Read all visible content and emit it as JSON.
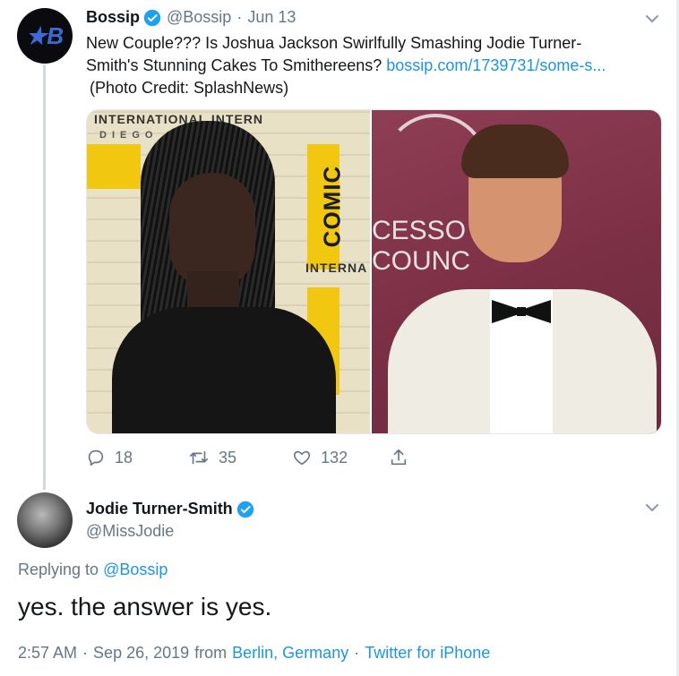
{
  "tweet": {
    "author_name": "Bossip",
    "handle": "@Bossip",
    "date": "Jun 13",
    "text_line1": "New Couple??? Is Joshua Jackson Swirlfully Smashing Jodie Turner-",
    "text_line2_plain": "Smith's Stunning Cakes To Smithereens? ",
    "link_text": "bossip.com/1739731/some-s...",
    "credit": "(Photo Credit: SplashNews)",
    "avatar_glyph": "★B",
    "media": {
      "left_sign_top": "INTERNATIONAL   INTERN",
      "left_sign_sub": "DIEGO   SAN D",
      "left_comic": "COMIC",
      "left_sign_mid": "INTERNA",
      "right_sign": "CESSO",
      "right_sign2": "COUNC"
    },
    "actions": {
      "replies": "18",
      "retweets": "35",
      "likes": "132"
    }
  },
  "reply": {
    "author_name": "Jodie Turner-Smith",
    "handle": "@MissJodie",
    "replying_to_prefix": "Replying to ",
    "replying_to_handle": "@Bossip",
    "text": "yes. the answer is yes.",
    "time": "2:57 AM",
    "date": "Sep 26, 2019",
    "from": "from",
    "location": "Berlin, Germany",
    "client": "Twitter for iPhone"
  },
  "colors": {
    "link": "#1b95e0",
    "muted": "#657786",
    "verified": "#1da1f2"
  },
  "icons": [
    "verified-badge-icon",
    "chevron-down-icon",
    "reply-icon",
    "retweet-icon",
    "like-icon",
    "share-icon"
  ]
}
